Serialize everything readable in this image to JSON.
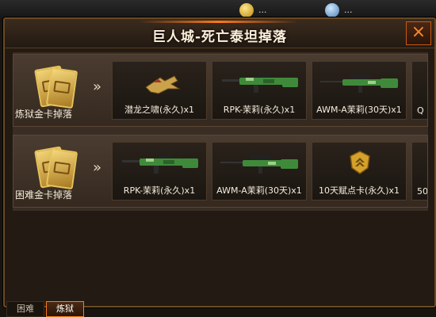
{
  "header": {
    "currency1": "...",
    "currency2": "..."
  },
  "dialog": {
    "title": "巨人城-死亡泰坦掉落",
    "close_icon": "×"
  },
  "rows": [
    {
      "label": "炼狱金卡掉落",
      "arrow": "»",
      "items": [
        {
          "name": "潜龙之啸(永久)x1",
          "icon": "dragon-weapon-icon"
        },
        {
          "name": "RPK-茉莉(永久)x1",
          "icon": "rifle-icon"
        },
        {
          "name": "AWM-A茉莉(30天)x1",
          "icon": "sniper-icon"
        },
        {
          "name": "Q",
          "icon": "partial-item"
        }
      ]
    },
    {
      "label": "困难金卡掉落",
      "arrow": "»",
      "items": [
        {
          "name": "RPK-茉莉(永久)x1",
          "icon": "rifle-icon"
        },
        {
          "name": "AWM-A茉莉(30天)x1",
          "icon": "sniper-icon"
        },
        {
          "name": "10天赋点卡(永久)x1",
          "icon": "talent-card-icon"
        },
        {
          "name": "50",
          "icon": "partial-item"
        }
      ]
    }
  ],
  "tabs": [
    {
      "label": "困难"
    },
    {
      "label": "炼狱"
    }
  ],
  "colors": {
    "accent": "#ff7a1a",
    "gold": "#e8c25a",
    "camo": "#3f8a3a"
  }
}
